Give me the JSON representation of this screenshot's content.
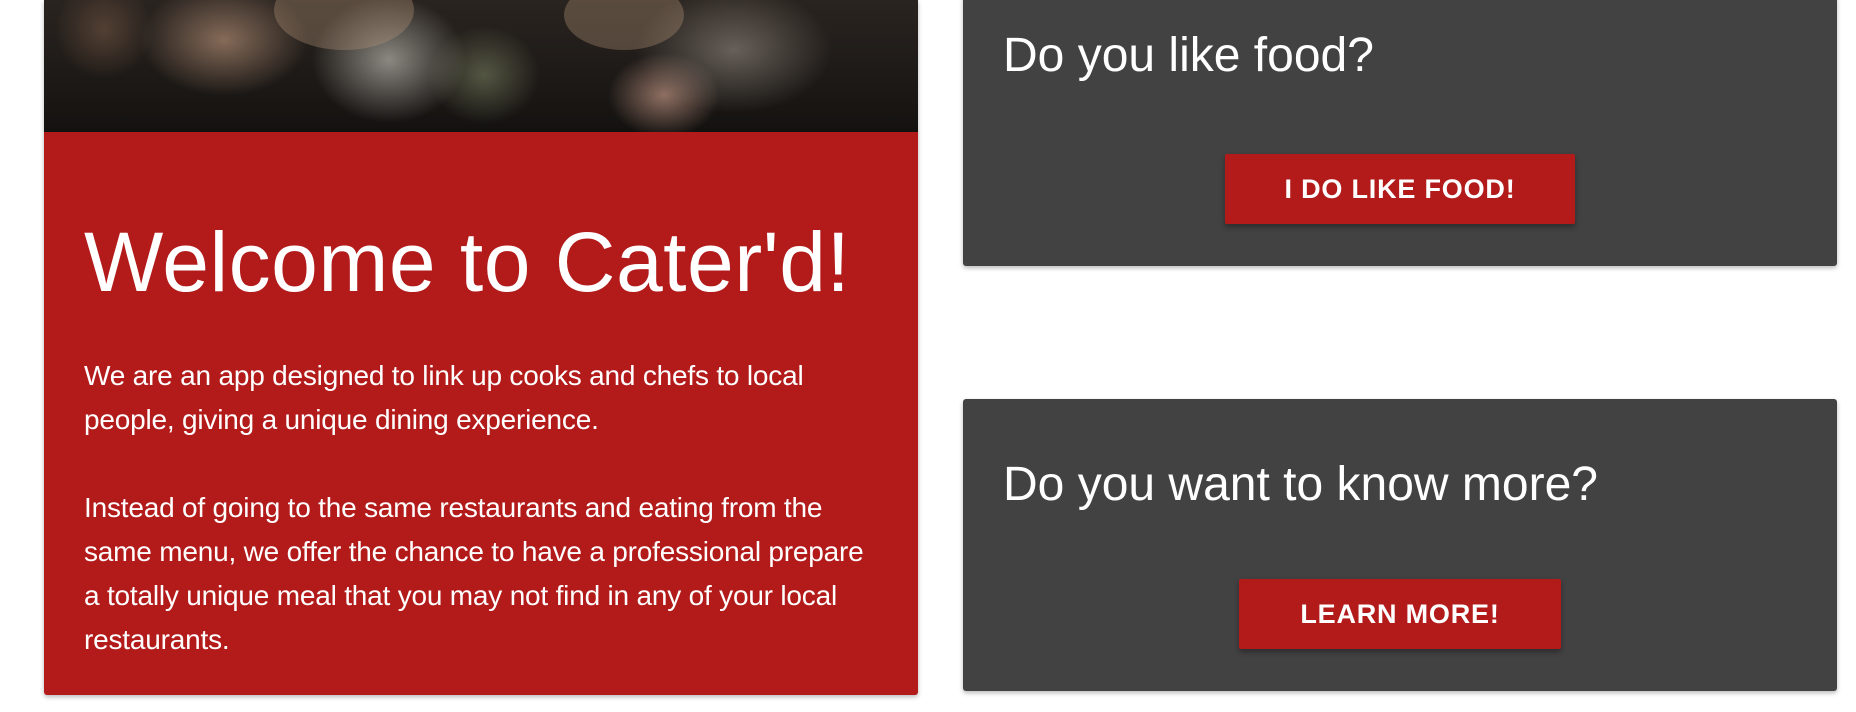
{
  "welcome": {
    "title": "Welcome to Cater'd!",
    "paragraph_1": "We are an app designed to link up cooks and chefs to local people, giving a unique dining experience.",
    "paragraph_2": "Instead of going to the same restaurants and eating from the same menu, we offer the chance to have a professional prepare a totally unique meal that you may not find in any of your local restaurants."
  },
  "food_card": {
    "heading": "Do you like food?",
    "button_label": "I DO LIKE FOOD!"
  },
  "more_card": {
    "heading": "Do you want to know more?",
    "button_label": "LEARN MORE!"
  },
  "colors": {
    "brand_red": "#b31b1b",
    "card_gray": "#424242",
    "text_white": "#ffffff"
  }
}
